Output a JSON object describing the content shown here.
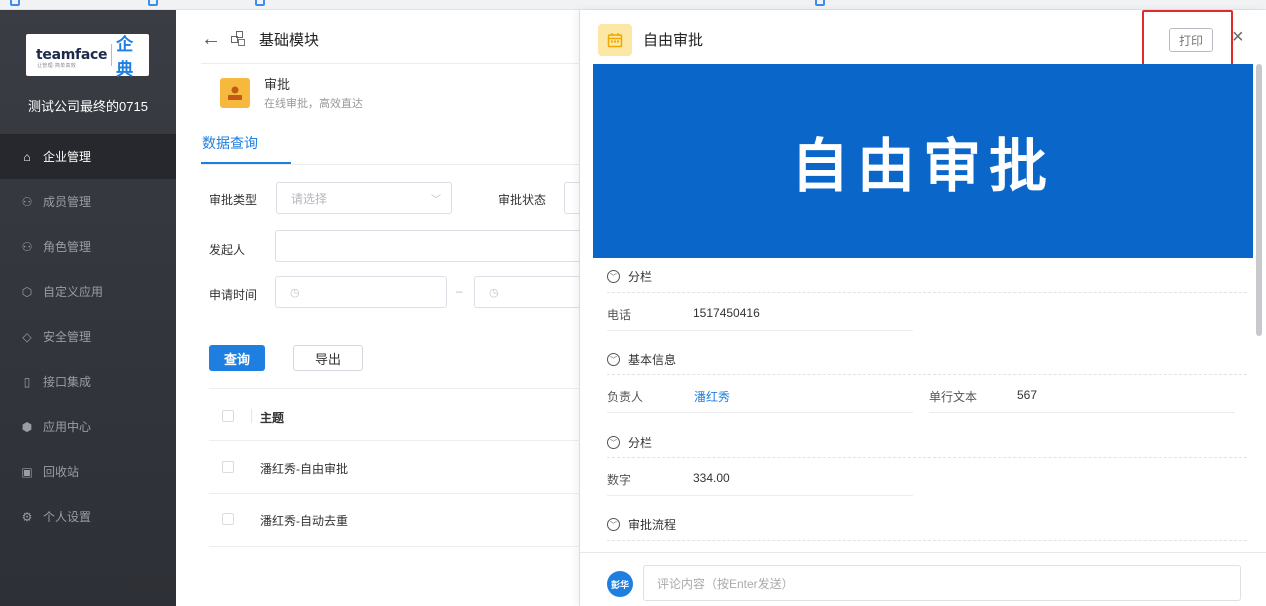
{
  "sidebar": {
    "logo_text": "teamface",
    "logo_sub": "让管理·简单高效",
    "logo_cn": "企典",
    "company": "测试公司最终的0715",
    "items": [
      {
        "label": "企业管理",
        "icon": "building-icon",
        "glyph": "⌂",
        "active": true
      },
      {
        "label": "成员管理",
        "icon": "members-icon",
        "glyph": "⚇",
        "active": false
      },
      {
        "label": "角色管理",
        "icon": "role-icon",
        "glyph": "⚇",
        "active": false
      },
      {
        "label": "自定义应用",
        "icon": "cube-icon",
        "glyph": "⬡",
        "active": false
      },
      {
        "label": "安全管理",
        "icon": "shield-icon",
        "glyph": "◇",
        "active": false
      },
      {
        "label": "接口集成",
        "icon": "interface-icon",
        "glyph": "▯",
        "active": false
      },
      {
        "label": "应用中心",
        "icon": "app-center-icon",
        "glyph": "⬢",
        "active": false
      },
      {
        "label": "回收站",
        "icon": "recycle-icon",
        "glyph": "▣",
        "active": false
      },
      {
        "label": "个人设置",
        "icon": "settings-icon",
        "glyph": "⚙",
        "active": false
      }
    ]
  },
  "module": {
    "title": "基础模块",
    "app_name": "审批",
    "app_desc": "在线审批，高效直达",
    "tab": "数据查询"
  },
  "filters": {
    "type_label": "审批类型",
    "type_placeholder": "请选择",
    "status_label": "审批状态",
    "initiator_label": "发起人",
    "time_label": "申请时间",
    "time_sep": "–"
  },
  "actions": {
    "query": "查询",
    "export": "导出"
  },
  "table": {
    "header": "主题",
    "rows": [
      "潘红秀-自由审批",
      "潘红秀-自动去重"
    ]
  },
  "panel": {
    "title": "自由审批",
    "print": "打印",
    "close": "×",
    "banner": "自由审批",
    "sections": {
      "s1": "分栏",
      "s2": "基本信息",
      "s3": "分栏",
      "s4": "审批流程"
    },
    "fields": {
      "phone_label": "电话",
      "phone_value": "1517450416",
      "owner_label": "负责人",
      "owner_value": "潘红秀",
      "text_label": "单行文本",
      "text_value": "567",
      "number_label": "数字",
      "number_value": "334.00"
    },
    "comment": {
      "avatar": "彭华",
      "placeholder": "评论内容（按Enter发送）"
    }
  },
  "colors": {
    "accent": "#1e7fe0",
    "banner": "#0a66c8",
    "sidebar": "#34373e",
    "highlight": "#e02b2b"
  }
}
